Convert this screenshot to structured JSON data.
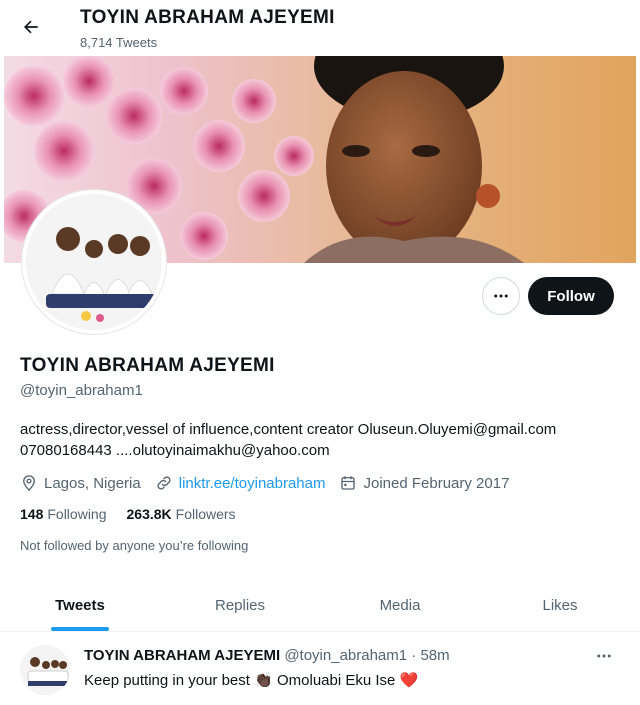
{
  "header": {
    "title": "TOYIN ABRAHAM AJEYEMI",
    "tweet_count": "8,714 Tweets"
  },
  "profile": {
    "name": "TOYIN ABRAHAM AJEYEMI",
    "handle": "@toyin_abraham1",
    "bio": "actress,director,vessel of influence,content creator Oluseun.Oluyemi@gmail.com 07080168443 ....olutoyinaimakhu@yahoo.com",
    "location": "Lagos, Nigeria",
    "link": "linktr.ee/toyinabraham",
    "joined": "Joined February 2017",
    "following_count": "148",
    "following_label": "Following",
    "followers_count": "263.8K",
    "followers_label": "Followers",
    "not_followed_text": "Not followed by anyone you’re following",
    "follow_button": "Follow"
  },
  "tabs": [
    {
      "label": "Tweets",
      "active": true
    },
    {
      "label": "Replies",
      "active": false
    },
    {
      "label": "Media",
      "active": false
    },
    {
      "label": "Likes",
      "active": false
    }
  ],
  "tweet": {
    "name": "TOYIN ABRAHAM AJEYEMI",
    "meta": "@toyin_abraham1 · 58m",
    "text_before": "Keep putting in your best ",
    "text_middle": " Omoluabi Eku Ise ",
    "emoji_1": "👏🏿",
    "emoji_2": "❤️"
  },
  "icons": {
    "back": "arrow-left-icon",
    "more": "more-dots-icon",
    "location": "location-pin-icon",
    "link": "link-icon",
    "calendar": "calendar-icon"
  },
  "colors": {
    "accent": "#1d9bf0",
    "text": "#0f1419",
    "muted": "#536471",
    "follow_bg": "#0f1419"
  }
}
